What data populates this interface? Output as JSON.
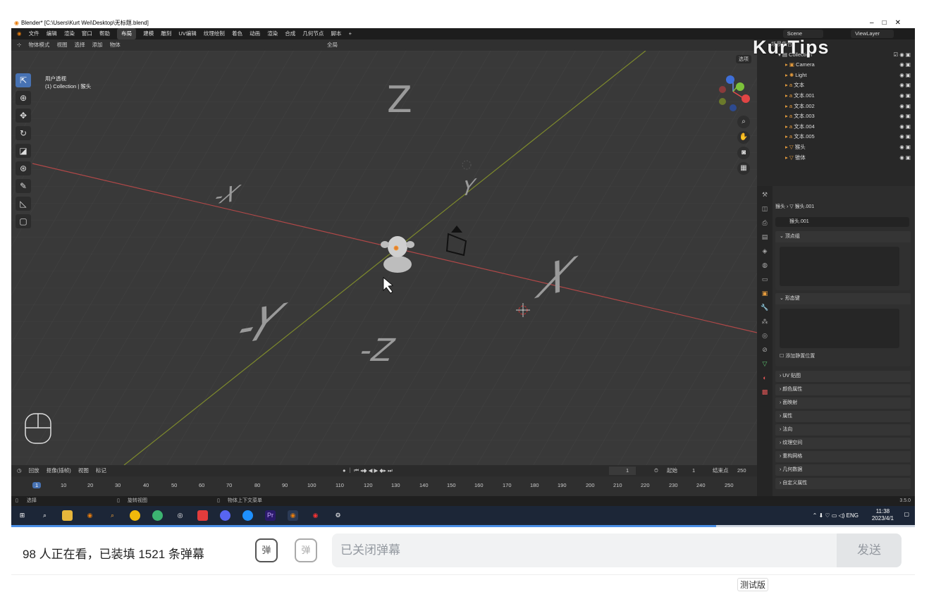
{
  "window_title": "Blender* [C:\\Users\\Kurt Wei\\Desktop\\无标题.blend]",
  "menu": [
    "文件",
    "编辑",
    "渲染",
    "窗口",
    "帮助"
  ],
  "workspaces": [
    "布局",
    "建模",
    "雕刻",
    "UV编辑",
    "纹理绘制",
    "着色",
    "动画",
    "渲染",
    "合成",
    "几何节点",
    "脚本",
    "+"
  ],
  "active_workspace": "布局",
  "scene_name": "Scene",
  "view_layer": "ViewLayer",
  "viewport_header": {
    "mode": "物体模式",
    "items": [
      "视图",
      "选择",
      "添加",
      "物体"
    ],
    "transform": "全局",
    "options": "选项"
  },
  "viewport": {
    "view_name": "用户透视",
    "collection_info": "(1) Collection | 猴头",
    "axis_labels": {
      "z": "Z",
      "neg_z": "-Z",
      "y": "Y",
      "neg_y": "-Y",
      "x": "X",
      "neg_x": "-X"
    }
  },
  "watermark": "KurTips",
  "outliner": {
    "header": "场景集合",
    "items": [
      {
        "name": "Collection",
        "color": "#ddd"
      },
      {
        "name": "Camera",
        "color": "#ddd"
      },
      {
        "name": "Light",
        "color": "#ddd"
      },
      {
        "name": "文本",
        "color": "#ddd"
      },
      {
        "name": "文本.001",
        "color": "#ddd"
      },
      {
        "name": "文本.002",
        "color": "#ddd"
      },
      {
        "name": "文本.003",
        "color": "#ddd"
      },
      {
        "name": "文本.004",
        "color": "#ddd"
      },
      {
        "name": "文本.005",
        "color": "#ddd"
      },
      {
        "name": "猴头",
        "color": "#ddd"
      },
      {
        "name": "锥体",
        "color": "#ddd"
      }
    ]
  },
  "properties": {
    "breadcrumb_obj": "猴头",
    "breadcrumb_mesh": "猴头.001",
    "mesh_name": "猴头.001",
    "panel_vertex_groups": "顶点组",
    "panel_shape_keys": "形态键",
    "add_rest_position": "添加静置位置",
    "collapsed_panels": [
      "UV 贴图",
      "颜色属性",
      "面映射",
      "属性",
      "法向",
      "纹理空间",
      "重构网格",
      "几何数据",
      "自定义属性"
    ]
  },
  "timeline": {
    "header": [
      "回放",
      "抠像(插帧)",
      "视图",
      "标记"
    ],
    "current_frame": "1",
    "start_label": "起始",
    "start": "1",
    "end_label": "结束点",
    "end": "250",
    "ticks": [
      "1",
      "10",
      "20",
      "30",
      "40",
      "50",
      "60",
      "70",
      "80",
      "90",
      "100",
      "110",
      "120",
      "130",
      "140",
      "150",
      "160",
      "170",
      "180",
      "190",
      "200",
      "210",
      "220",
      "230",
      "240",
      "250"
    ]
  },
  "status_bar": {
    "left": "选择",
    "mid": "旋转视图",
    "right": "物体上下文菜单",
    "version": "3.5.0"
  },
  "taskbar": {
    "time": "11:38",
    "date": "2023/4/1",
    "lang": "ENG"
  },
  "video_progress": 0.78,
  "bottom": {
    "viewers": "98 人正在看，已装填 1521 条弹幕",
    "danmu_icon1": "弹",
    "danmu_icon2": "弹",
    "input_placeholder": "已关闭弹幕",
    "send": "发送",
    "beta": "测试版"
  }
}
